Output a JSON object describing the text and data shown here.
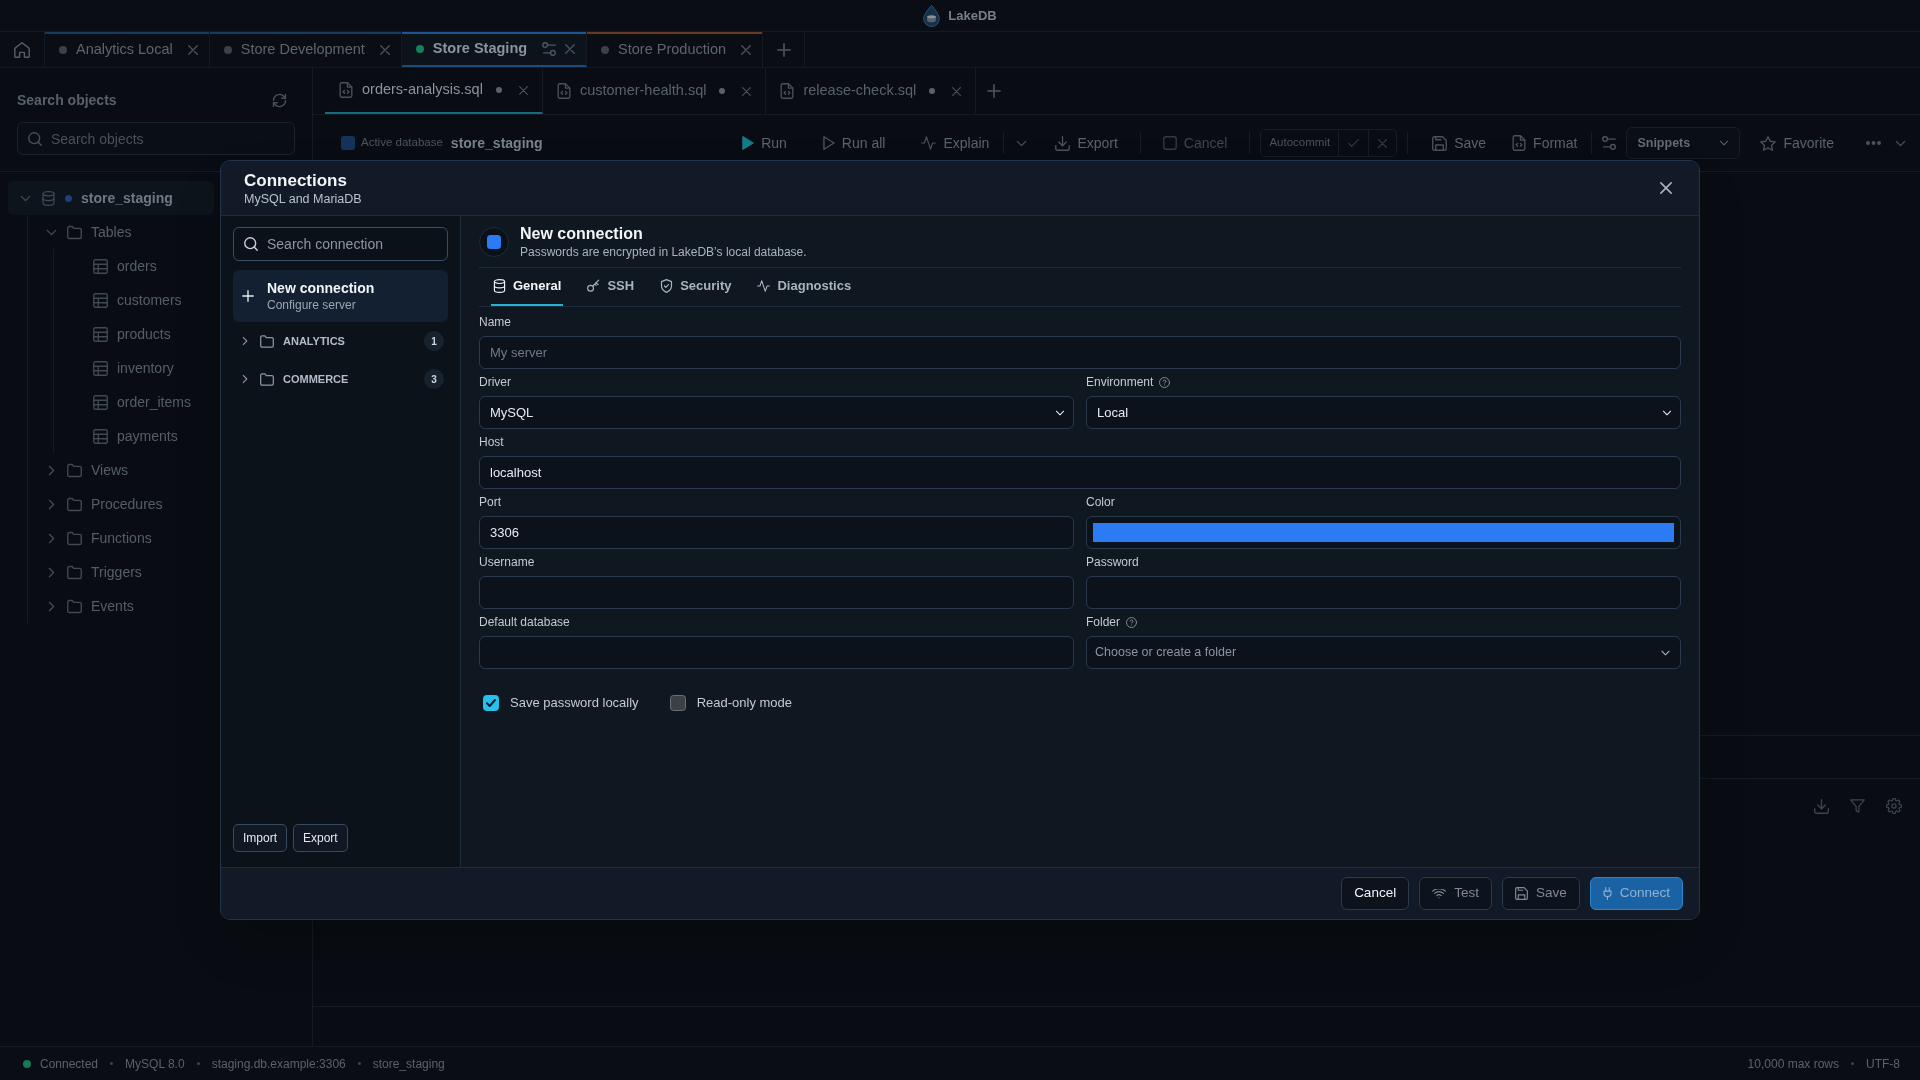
{
  "window": {
    "title": "LakeDB"
  },
  "connection_tabs": [
    {
      "label": "Analytics Local",
      "connected": false,
      "selected": false,
      "color": "#173a5e"
    },
    {
      "label": "Store Development",
      "connected": false,
      "selected": false,
      "color": "#173a5e"
    },
    {
      "label": "Store Staging",
      "connected": true,
      "selected": true,
      "color": "#1d5690"
    },
    {
      "label": "Store Production",
      "connected": false,
      "selected": false,
      "color": "#673822"
    }
  ],
  "sidebar": {
    "title": "Search objects",
    "search": {
      "placeholder": "Search objects"
    },
    "tree": [
      {
        "label": "store_staging",
        "kind": "database",
        "active": true,
        "expanded": true,
        "selected": true,
        "children": [
          {
            "label": "Tables",
            "kind": "folder",
            "expanded": true,
            "selected": false,
            "children": [
              {
                "label": "orders",
                "kind": "table",
                "selected": false
              },
              {
                "label": "customers",
                "kind": "table",
                "selected": false
              },
              {
                "label": "products",
                "kind": "table",
                "selected": false
              },
              {
                "label": "inventory",
                "kind": "table",
                "selected": false
              },
              {
                "label": "order_items",
                "kind": "table",
                "selected": false
              },
              {
                "label": "payments",
                "kind": "table",
                "selected": false
              }
            ]
          },
          {
            "label": "Views",
            "kind": "folder",
            "expanded": false,
            "selected": false
          },
          {
            "label": "Procedures",
            "kind": "folder",
            "expanded": false,
            "selected": false
          },
          {
            "label": "Functions",
            "kind": "folder",
            "expanded": false,
            "selected": false
          },
          {
            "label": "Triggers",
            "kind": "folder",
            "expanded": false,
            "selected": false
          },
          {
            "label": "Events",
            "kind": "folder",
            "expanded": false,
            "selected": false
          }
        ]
      }
    ]
  },
  "editor_tabs": [
    {
      "label": "orders-analysis.sql",
      "modified": true,
      "selected": true
    },
    {
      "label": "customer-health.sql",
      "modified": true,
      "selected": false
    },
    {
      "label": "release-check.sql",
      "modified": true,
      "selected": false
    }
  ],
  "toolbar": {
    "active_database_label": "Active database",
    "active_database": "store_staging",
    "run_actions": [
      {
        "label": "Run",
        "disabled": false
      },
      {
        "label": "Run all",
        "disabled": false
      },
      {
        "label": "Explain",
        "disabled": false
      }
    ],
    "export": {
      "label": "Export",
      "disabled": false
    },
    "cancel": {
      "label": "Cancel",
      "disabled": true
    },
    "autocommit": {
      "label": "Autocommit"
    },
    "file_actions": [
      {
        "label": "Save"
      },
      {
        "label": "Format"
      }
    ],
    "snippets": {
      "value": "Snippets"
    },
    "favorite": {
      "label": "Favorite"
    }
  },
  "dialog": {
    "title": "Connections",
    "subtitle": "MySQL and MariaDB",
    "sidebar": {
      "search": {
        "placeholder": "Search connection"
      },
      "new_connection": {
        "title": "New connection",
        "subtitle": "Configure server",
        "selected": true
      },
      "folders": [
        {
          "name": "ANALYTICS",
          "count": "1",
          "expanded": false
        },
        {
          "name": "COMMERCE",
          "count": "3",
          "expanded": false
        }
      ],
      "buttons": [
        "Import",
        "Export"
      ]
    },
    "header": {
      "title": "New connection",
      "subtitle": "Passwords are encrypted in LakeDB’s local database."
    },
    "tabs": [
      {
        "label": "General",
        "selected": true
      },
      {
        "label": "SSH",
        "selected": false
      },
      {
        "label": "Security",
        "selected": false
      },
      {
        "label": "Diagnostics",
        "selected": false
      }
    ],
    "form_rows": [
      [
        {
          "kind": "text",
          "label": "Name",
          "placeholder": "My server"
        }
      ],
      [
        {
          "kind": "select",
          "label": "Driver",
          "value": "MySQL"
        },
        {
          "kind": "select",
          "label": "Environment",
          "value": "Local",
          "help": true
        }
      ],
      [
        {
          "kind": "text",
          "label": "Host",
          "value": "localhost"
        }
      ],
      [
        {
          "kind": "text",
          "label": "Port",
          "value": "3306"
        },
        {
          "kind": "color",
          "label": "Color",
          "color": "#2b7cf4"
        }
      ],
      [
        {
          "kind": "text",
          "label": "Username"
        },
        {
          "kind": "password",
          "label": "Password"
        }
      ],
      [
        {
          "kind": "text",
          "label": "Default database"
        },
        {
          "kind": "combo",
          "label": "Folder",
          "placeholder": "Choose or create a folder",
          "help": true
        }
      ]
    ],
    "checkboxes": [
      {
        "label": "Save password locally",
        "checked": true
      },
      {
        "label": "Read-only mode",
        "checked": false
      }
    ],
    "footer_buttons": [
      {
        "label": "Cancel",
        "kind": "secondary",
        "disabled": false
      },
      {
        "label": "Test",
        "kind": "secondary",
        "disabled": true
      },
      {
        "label": "Save",
        "kind": "secondary",
        "disabled": true
      },
      {
        "label": "Connect",
        "kind": "primary",
        "disabled": true
      }
    ]
  },
  "status_bar": {
    "connected": true,
    "items": [
      "Connected",
      "MySQL 8.0",
      "staging.db.example:3306",
      "store_staging"
    ],
    "right_items": [
      "10,000 max rows",
      "UTF-8"
    ]
  }
}
